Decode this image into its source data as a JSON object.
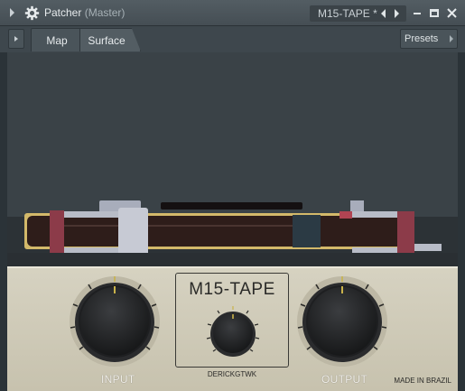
{
  "window": {
    "title": "Patcher",
    "subtitle": "(Master)",
    "preset_name": "M15-TAPE *"
  },
  "tabs": [
    {
      "label": "Map",
      "active": false
    },
    {
      "label": "Surface",
      "active": true
    }
  ],
  "presets_label": "Presets",
  "plugin": {
    "brand": "M15-TAPE",
    "author": "DERICKGTWK",
    "input_label": "INPUT",
    "output_label": "OUTPUT",
    "made_in": "MADE IN BRAZIL"
  },
  "icons": {
    "collapse": "triangle-right-icon",
    "settings": "gear-icon",
    "prev_preset": "triangle-left-icon",
    "next_preset": "triangle-right-icon",
    "minimize": "minimize-icon",
    "maximize": "maximize-icon",
    "close": "close-icon"
  },
  "colors": {
    "titlebar": "#4d565c",
    "panel": "#d0ccb9",
    "tape": "#2e1d1a",
    "tape_accent": "#8c3b49",
    "guide_metal": "#b8bcc7"
  }
}
